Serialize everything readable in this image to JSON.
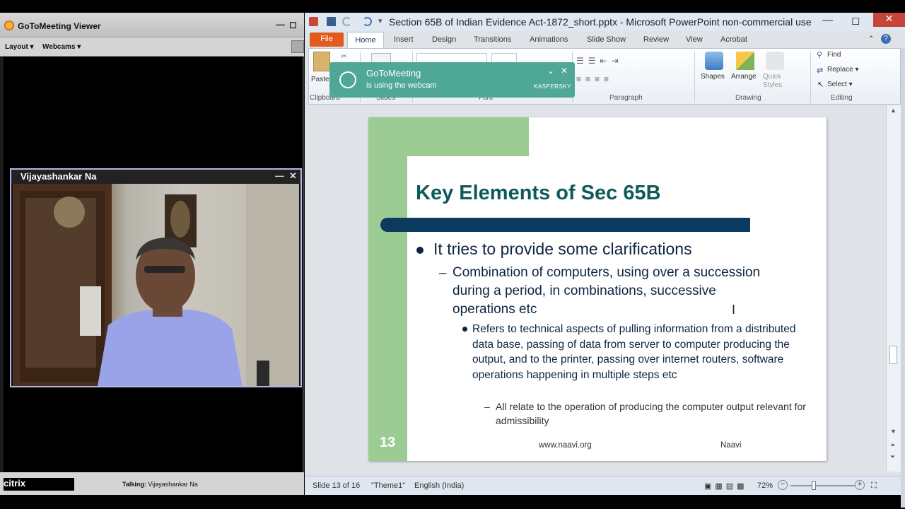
{
  "gtm": {
    "title": "GoToMeeting Viewer",
    "layout_label": "Layout",
    "webcams_label": "Webcams",
    "minimize": "—",
    "restore": "◻",
    "camera_name": "Vijayashankar Na",
    "cam_minimize": "—",
    "cam_close": "✕",
    "talking_label": "Talking:",
    "talking_name": "Vijayashankar Na",
    "footer_logo": "citrix"
  },
  "ppt": {
    "title": "Section 65B of Indian Evidence Act-1872_short.pptx  -  Microsoft PowerPoint non-commercial use",
    "min": "—",
    "max": "◻",
    "close": "✕",
    "tabs": [
      "File",
      "Home",
      "Insert",
      "Design",
      "Transitions",
      "Animations",
      "Slide Show",
      "Review",
      "View",
      "Acrobat"
    ],
    "ribbon": {
      "paste": "Paste",
      "groups": [
        "Clipboard",
        "Slides",
        "Font",
        "Paragraph",
        "Drawing",
        "Editing"
      ],
      "shapes": "Shapes",
      "arrange": "Arrange",
      "quick_styles": "Quick\nStyles",
      "find": "Find",
      "replace": "Replace ▾",
      "select": "Select ▾"
    },
    "toast": {
      "title": "GoToMeeting",
      "message": "is using the webcam",
      "brand": "KASPERSKY",
      "collapse": "⌄",
      "close": "✕"
    },
    "slide": {
      "title": "Key Elements of Sec 65B",
      "level1": "It tries to provide some clarifications",
      "level2": "Combination of computers, using over a succession during a period, in combinations, successive operations etc",
      "level3": "Refers to technical aspects of pulling information from a distributed data base, passing of data from server to computer producing the output, and to the printer, passing over internet routers, software operations happening in multiple steps etc",
      "level4": "All relate to the operation of producing the computer output relevant for admissibility",
      "number": "13",
      "url": "www.naavi.org",
      "author": "Naavi"
    },
    "status": {
      "slide": "Slide 13 of 16",
      "theme": "\"Theme1\"",
      "language": "English (India)",
      "zoom": "72%",
      "zoom_minus": "−",
      "zoom_plus": "+"
    },
    "colors": {
      "file_tab": "#e25a1c",
      "slide_green": "#9dcb94",
      "title_teal": "#0e5a5a",
      "bar_navy": "#0d3a5f",
      "toast_green": "#4fa895"
    }
  }
}
